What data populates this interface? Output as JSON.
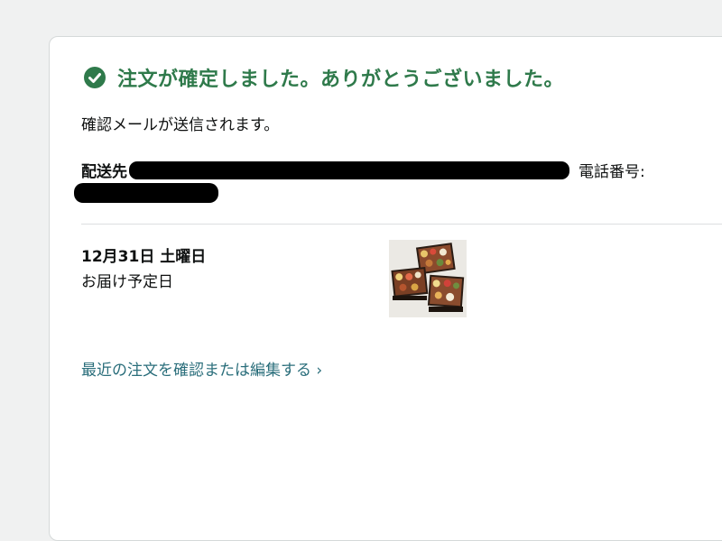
{
  "confirmation": {
    "title": "注文が確定しました。ありがとうございました。",
    "email_note": "確認メールが送信されます。"
  },
  "shipping": {
    "label": "配送先",
    "phone_label": "電話番号:"
  },
  "delivery": {
    "date": "12月31日 土曜日",
    "sub_label": "お届け予定日"
  },
  "links": {
    "recent_orders": "最近の注文を確認または編集する ›"
  },
  "colors": {
    "success_green": "#2f7a4b",
    "link_teal": "#2a6e7b"
  },
  "icons": {
    "confirm": "check-circle-icon"
  }
}
